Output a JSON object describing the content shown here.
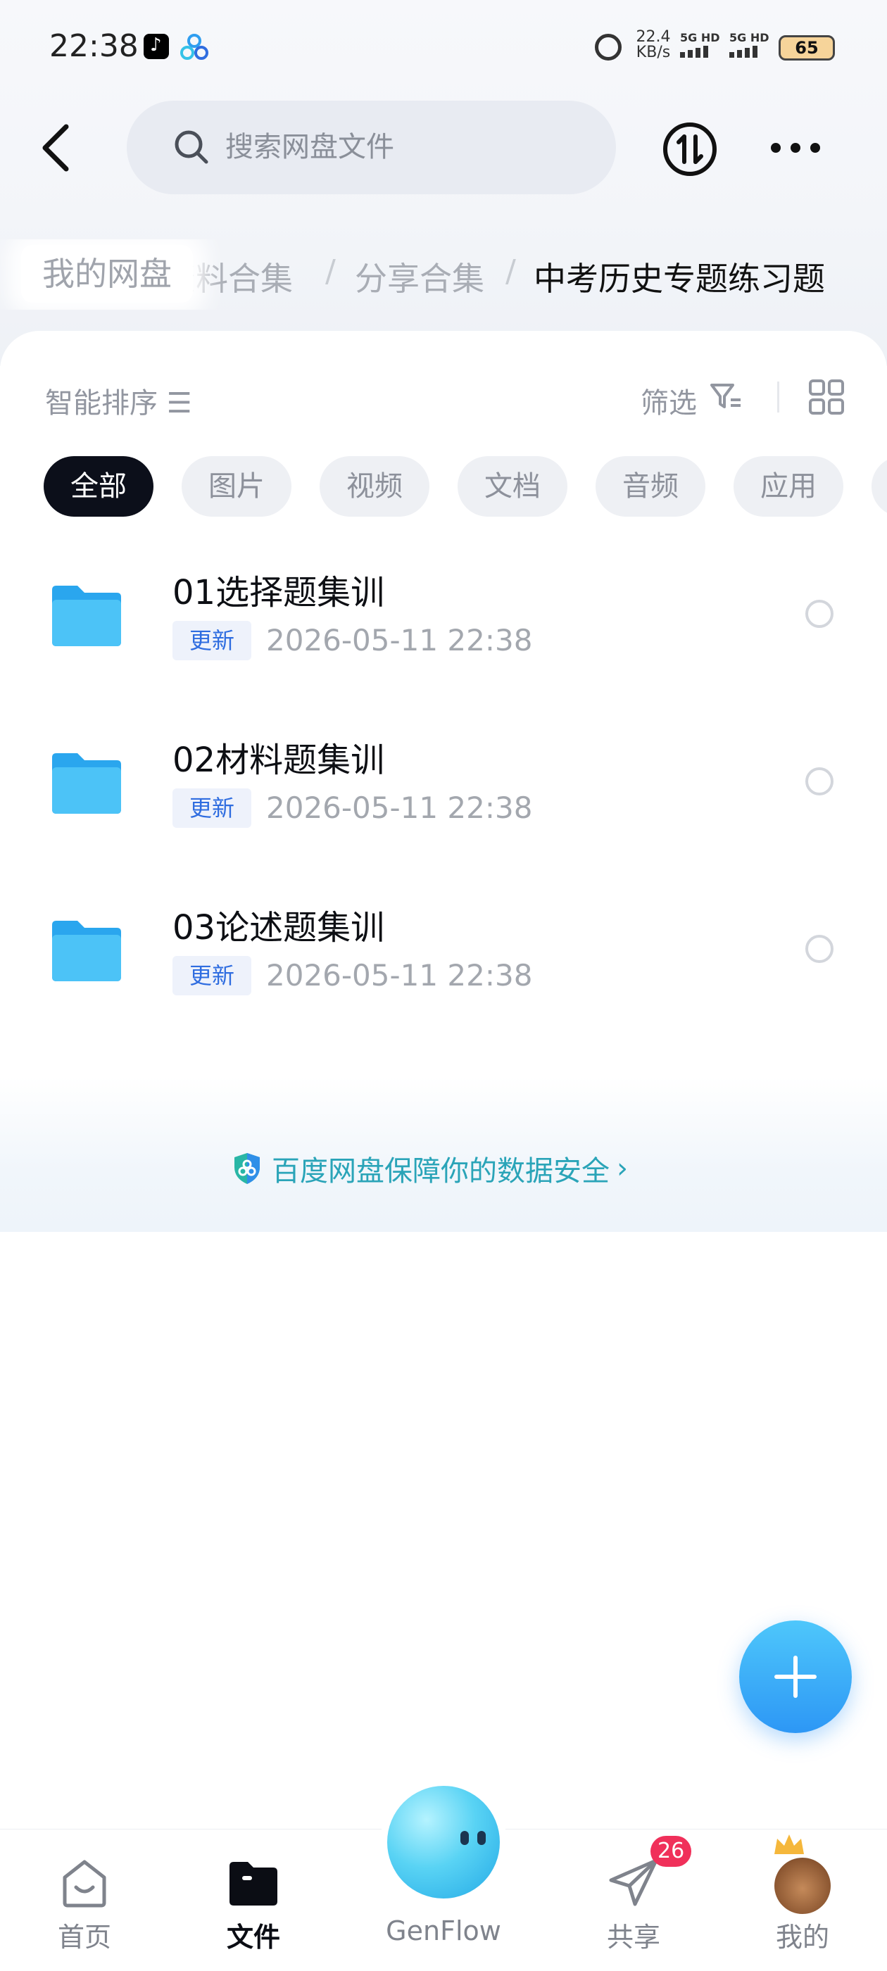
{
  "status_bar": {
    "time": "22:38",
    "net_speed_value": "22.4",
    "net_speed_unit": "KB/s",
    "sim1_label": "5G HD",
    "sim2_label": "5G HD",
    "battery": "65"
  },
  "header": {
    "search_placeholder": "搜索网盘文件"
  },
  "breadcrumb": {
    "home": "我的网盘",
    "items": [
      "资料合集",
      "分享合集"
    ],
    "current": "中考历史专题练习题"
  },
  "toolbar": {
    "sort_label": "智能排序 ☰",
    "filter_label": "筛选"
  },
  "filter_chips": [
    {
      "label": "全部",
      "active": true
    },
    {
      "label": "图片",
      "active": false
    },
    {
      "label": "视频",
      "active": false
    },
    {
      "label": "文档",
      "active": false
    },
    {
      "label": "音频",
      "active": false
    },
    {
      "label": "应用",
      "active": false
    }
  ],
  "files": [
    {
      "name": "01选择题集训",
      "tag": "更新",
      "date": "2026-05-11  22:38"
    },
    {
      "name": "02材料题集训",
      "tag": "更新",
      "date": "2026-05-11  22:38"
    },
    {
      "name": "03论述题集训",
      "tag": "更新",
      "date": "2026-05-11  22:38"
    }
  ],
  "security": {
    "text": "百度网盘保障你的数据安全",
    "chevron": "›"
  },
  "bottom_nav": {
    "items": [
      {
        "label": "首页",
        "active": false
      },
      {
        "label": "文件",
        "active": true
      },
      {
        "label": "GenFlow",
        "active": false
      },
      {
        "label": "共享",
        "active": false
      },
      {
        "label": "我的",
        "active": false
      }
    ],
    "share_badge": "26"
  },
  "colors": {
    "accent_blue": "#2f6de0",
    "security_teal": "#2aa4b8",
    "badge_red": "#f0305a",
    "fab_blue": "#2d97f5",
    "folder_blue": "#3fb6f2"
  }
}
